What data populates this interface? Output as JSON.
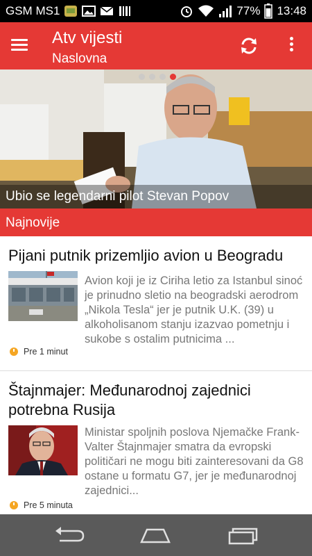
{
  "status_bar": {
    "carrier": "GSM MS1",
    "battery": "77%",
    "time": "13:48"
  },
  "app_bar": {
    "title": "Atv vijesti",
    "subtitle": "Naslovna"
  },
  "hero": {
    "caption": "Ubio se legendarni pilot Stevan Popov",
    "slides_total": 4,
    "active_slide": 4
  },
  "section": {
    "label": "Najnovije"
  },
  "articles": [
    {
      "headline": "Pijani putnik prizemljio avion u Beogradu",
      "summary": "Avion koji je iz Ciriha letio za Istanbul sinoć je prinudno sletio na beogradski aerodrom „Nikola Tesla“ jer je putnik U.K. (39) u alkoholisanom stanju izazvao pometnju i sukobe s ostalim putnicima ...",
      "time": "Pre 1 minut"
    },
    {
      "headline": "Štajnmajer: Međunarodnoj zajednici potrebna Rusija",
      "summary": "Ministar spoljnih poslova Njemačke Frank-Valter Štajnmajer smatra da evropski političari ne mogu biti zainteresovani da G8 ostane u formatu G7, jer je međunarodnoj zajednici...",
      "time": "Pre 5 minuta"
    }
  ],
  "colors": {
    "accent": "#e53935",
    "status_bar": "#000000",
    "nav_bar": "#5a5a5a"
  }
}
